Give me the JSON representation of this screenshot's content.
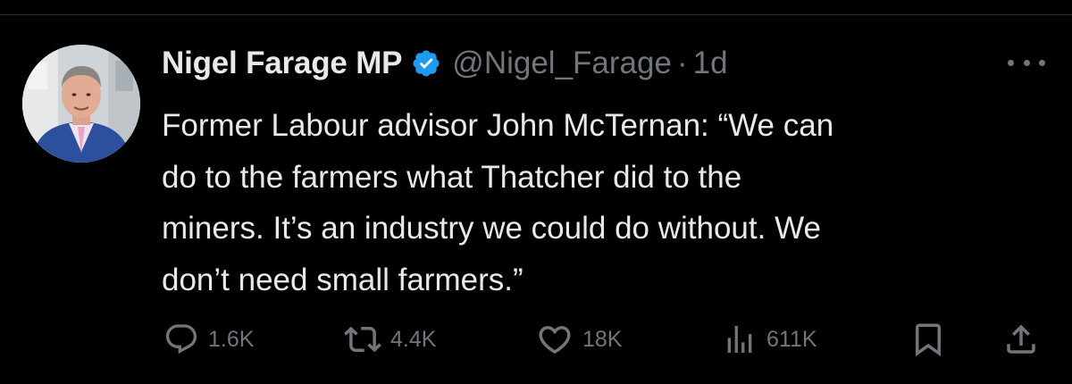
{
  "author": {
    "display_name": "Nigel Farage MP",
    "handle": "@Nigel_Farage",
    "separator": "·",
    "time": "1d",
    "verified": true,
    "verified_color": "#1d9bf0",
    "avatar_icon": "avatar-photo"
  },
  "tweet": {
    "lines": [
      "Former Labour advisor John McTernan: “We can",
      "do to the farmers what Thatcher did to the",
      "miners. It’s an industry we could do without. We",
      "don’t need small farmers.”"
    ]
  },
  "actions": {
    "reply_count": "1.6K",
    "retweet_count": "4.4K",
    "like_count": "18K",
    "views_count": "611K",
    "reply_icon": "speech-bubble-icon",
    "retweet_icon": "retweet-icon",
    "like_icon": "heart-icon",
    "views_icon": "bar-chart-icon",
    "bookmark_icon": "bookmark-icon",
    "share_icon": "share-icon"
  },
  "colors": {
    "background": "#000000",
    "text_primary": "#e7e9ea",
    "text_secondary": "#71767b",
    "divider": "#2f3336"
  }
}
